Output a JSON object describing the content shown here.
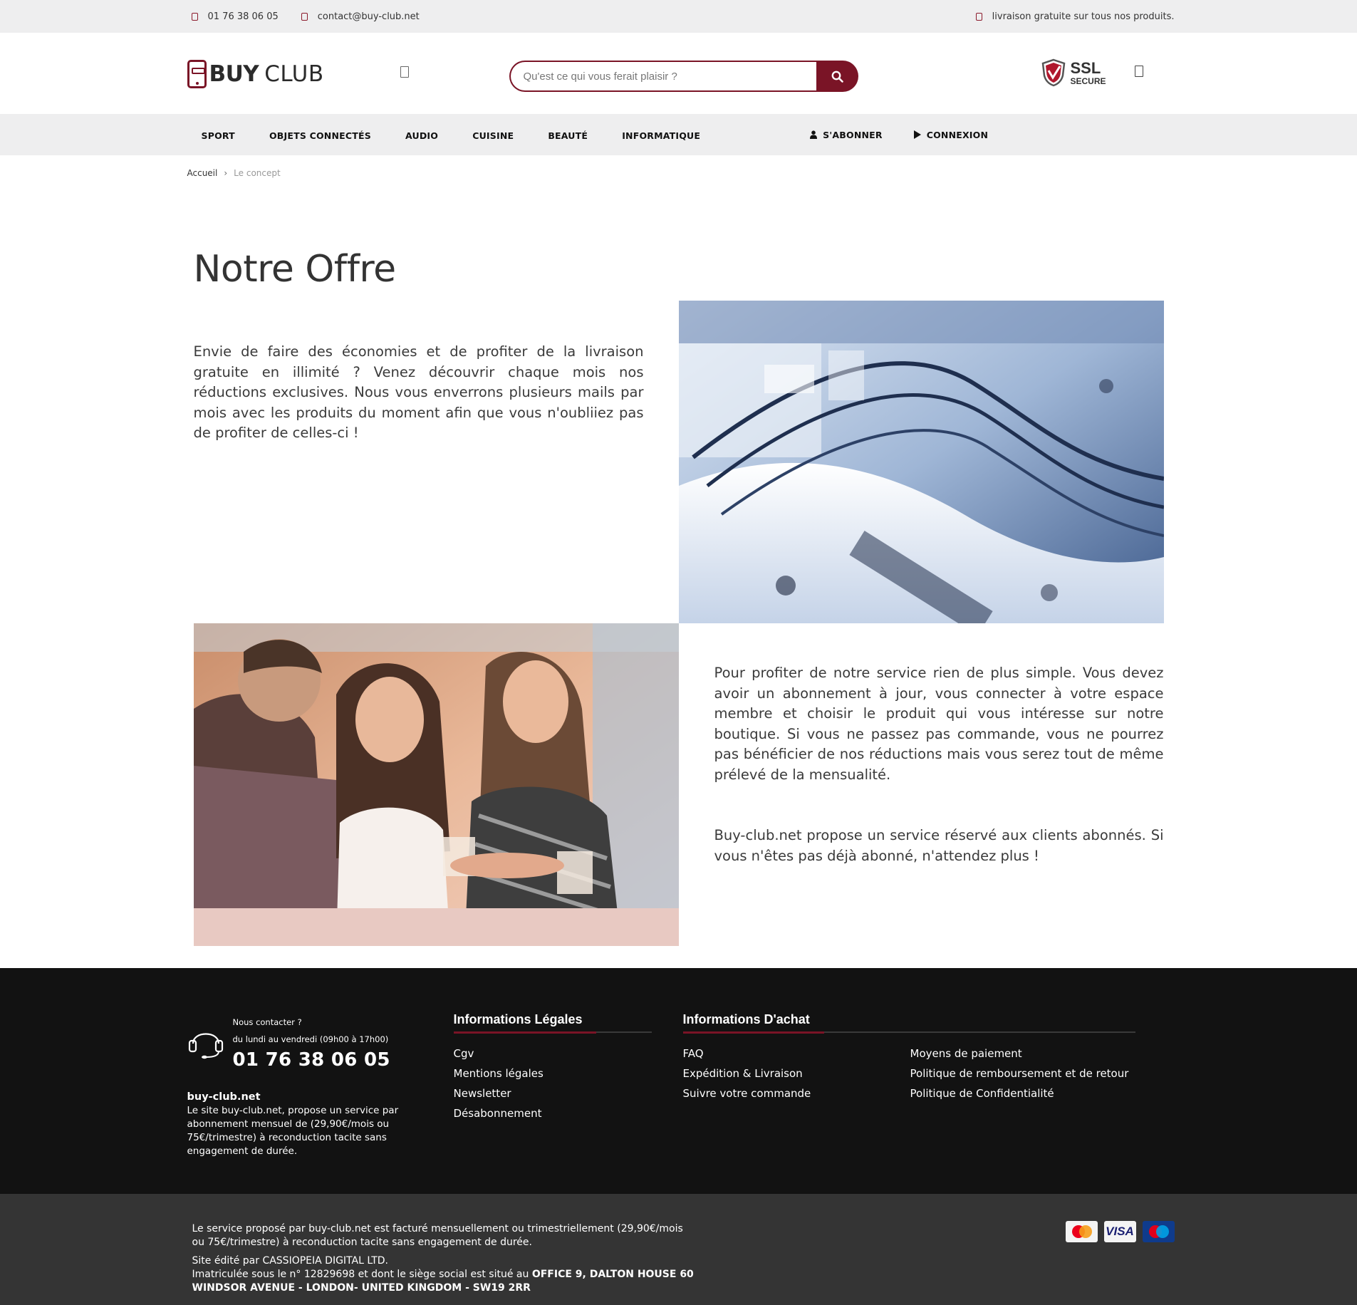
{
  "topbar": {
    "phone": "01 76 38 06 05",
    "email": "contact@buy-club.net",
    "shipping": "livraison gratuite sur tous nos produits."
  },
  "header": {
    "logo_bold": "BUY",
    "logo_light": "CLUB",
    "search_placeholder": "Qu'est ce qui vous ferait plaisir ?",
    "ssl_big": "SSL",
    "ssl_small": "SECURE"
  },
  "nav": {
    "categories": [
      "SPORT",
      "OBJETS CONNECTÉS",
      "AUDIO",
      "CUISINE",
      "BEAUTÉ",
      "INFORMATIQUE"
    ],
    "subscribe": "S'ABONNER",
    "login": "CONNEXION"
  },
  "breadcrumb": {
    "home": "Accueil",
    "current": "Le concept"
  },
  "page": {
    "title": "Notre Offre",
    "text1": "Envie de faire des économies et de profiter de la livraison gratuite en illimité ? Venez découvrir chaque mois nos réductions exclusives. Nous vous enverrons plusieurs mails par mois avec les produits du moment afin que vous n'oubliiez pas de profiter de celles-ci !",
    "text2": "Pour profiter de notre service rien de plus simple. Vous devez avoir un abonnement à jour, vous connecter à votre espace membre et choisir le produit qui vous intéresse sur notre boutique. Si vous ne passez pas commande, vous ne pourrez pas bénéficier de nos réductions mais vous serez tout de même prélevé de la mensualité.",
    "text3": "Buy-club.net propose un service réservé aux clients abonnés. Si vous n'êtes pas déjà abonné, n'attendez plus !"
  },
  "footer": {
    "contact_label": "Nous contacter ?",
    "hours": "du lundi au vendredi (09h00 à 17h00)",
    "phone": "01 76 38 06 05",
    "site": "buy-club.net",
    "about": "Le site buy-club.net, propose un service par abonnement mensuel de (29,90€/mois ou 75€/trimestre) à reconduction tacite sans engagement de durée.",
    "legal_title": "Informations Légales",
    "legal_links": [
      "Cgv",
      "Mentions légales",
      "Newsletter",
      "Désabonnement"
    ],
    "achat_title": "Informations D'achat",
    "achat_links_1": [
      "FAQ",
      "Expédition & Livraison",
      "Suivre votre commande"
    ],
    "achat_links_2": [
      "Moyens de paiement",
      "Politique de remboursement et de retour",
      "Politique de Confidentialité"
    ]
  },
  "bottom": {
    "billing": "Le service proposé par buy-club.net est facturé mensuellement ou trimestriellement (29,90€/mois ou 75€/trimestre) à reconduction tacite sans engagement de durée.",
    "editor": "Site édité par CASSIOPEIA DIGITAL LTD.",
    "registration": "Imatriculée sous le n° 12829698 et dont le siège social est situé au ",
    "address": "OFFICE 9, DALTON HOUSE 60 WINDSOR AVENUE - LONDON- UNITED KINGDOM - SW19 2RR",
    "cards": {
      "mastercard": "MasterCard",
      "visa": "VISA",
      "maestro": "Maestro"
    }
  },
  "colors": {
    "brand": "#7a1426",
    "topbar_bg": "#eeeeef",
    "footer_bg": "#121212",
    "bottom_bg": "#343434"
  }
}
